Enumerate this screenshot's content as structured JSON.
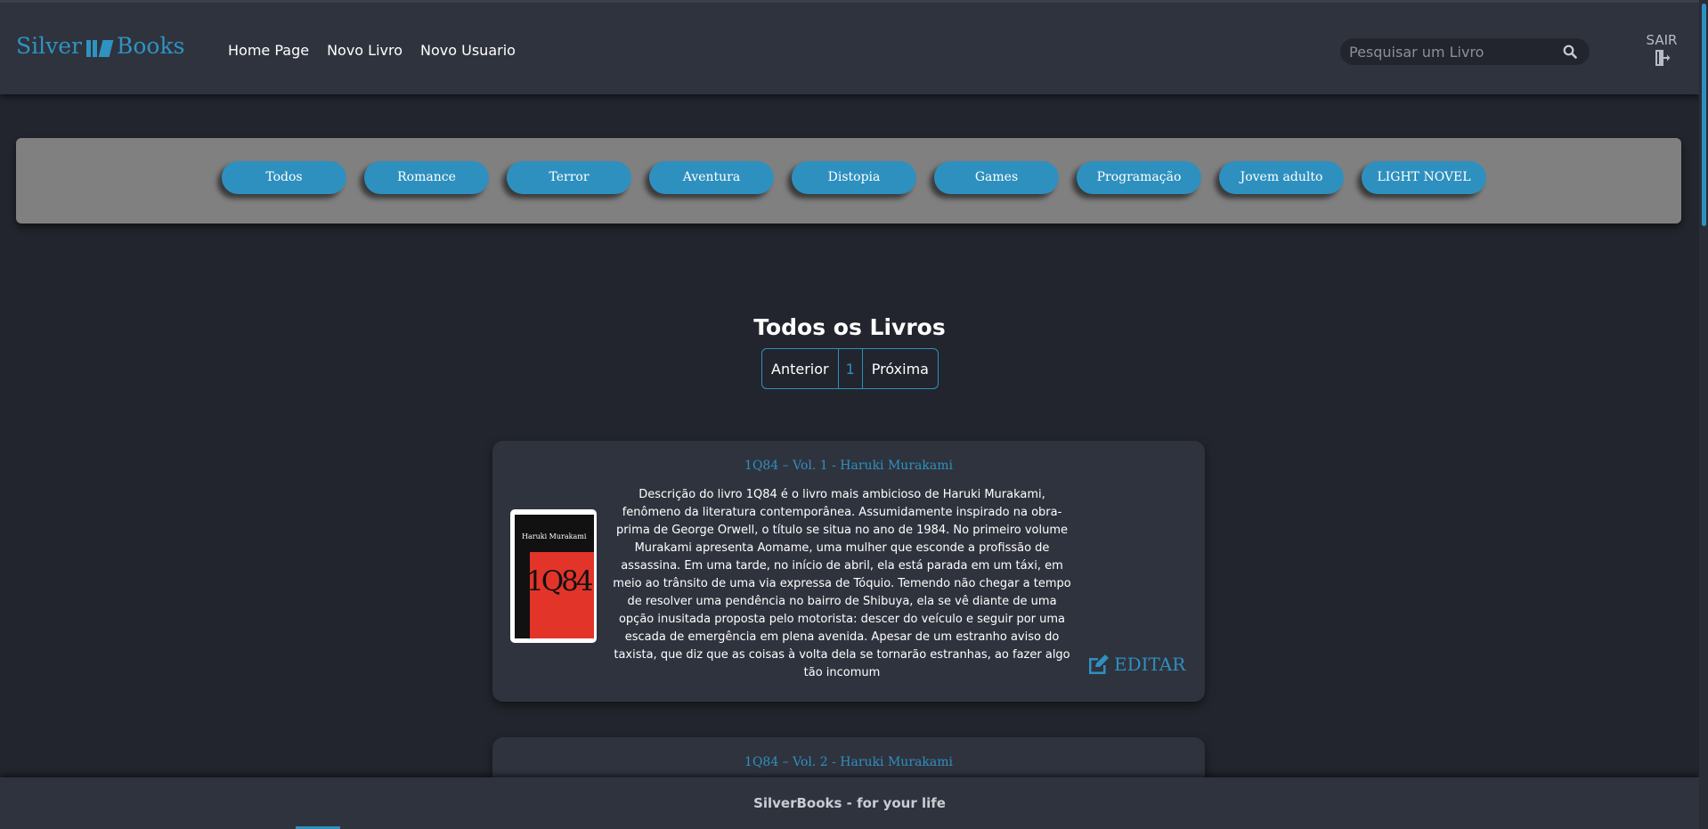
{
  "header": {
    "logo_left": "Silver",
    "logo_right": "Books",
    "nav": [
      {
        "label": "Home Page"
      },
      {
        "label": "Novo Livro"
      },
      {
        "label": "Novo Usuario"
      }
    ],
    "search": {
      "placeholder": "Pesquisar um Livro"
    },
    "logout_label": "SAIR"
  },
  "categories": [
    "Todos",
    "Romance",
    "Terror",
    "Aventura",
    "Distopia",
    "Games",
    "Programação",
    "Jovem adulto",
    "LIGHT NOVEL"
  ],
  "main": {
    "heading": "Todos os Livros",
    "pager": {
      "prev": "Anterior",
      "current": "1",
      "next": "Próxima"
    }
  },
  "books": [
    {
      "title": "1Q84 – Vol. 1 - Haruki Murakami",
      "cover_author": "Haruki Murakami",
      "cover_title": "1Q84",
      "description": "Descrição do livro 1Q84 é o livro mais ambicioso de Haruki Murakami, fenômeno da literatura contemporânea. Assumidamente inspirado na obra-prima de George Orwell, o título se situa no ano de 1984. No primeiro volume Murakami apresenta Aomame, uma mulher que esconde a profissão de assassina. Em uma tarde, no início de abril, ela está parada em um táxi, em meio ao trânsito de uma via expressa de Tóquio. Temendo não chegar a tempo de resolver uma pendência no bairro de Shibuya, ela se vê diante de uma opção inusitada proposta pelo motorista: descer do veículo e seguir por uma escada de emergência em plena avenida. Apesar de um estranho aviso do taxista, que diz que as coisas à volta dela se tornarão estranhas, ao fazer algo tão incomum",
      "edit_label": "EDITAR"
    },
    {
      "title": "1Q84 – Vol. 2 - Haruki Murakami"
    }
  ],
  "footer": {
    "text": "SilverBooks - for your life"
  },
  "colors": {
    "accent": "#2e90bf",
    "background": "#22252d",
    "panel": "#2f333e",
    "category_bar": "#808080"
  }
}
